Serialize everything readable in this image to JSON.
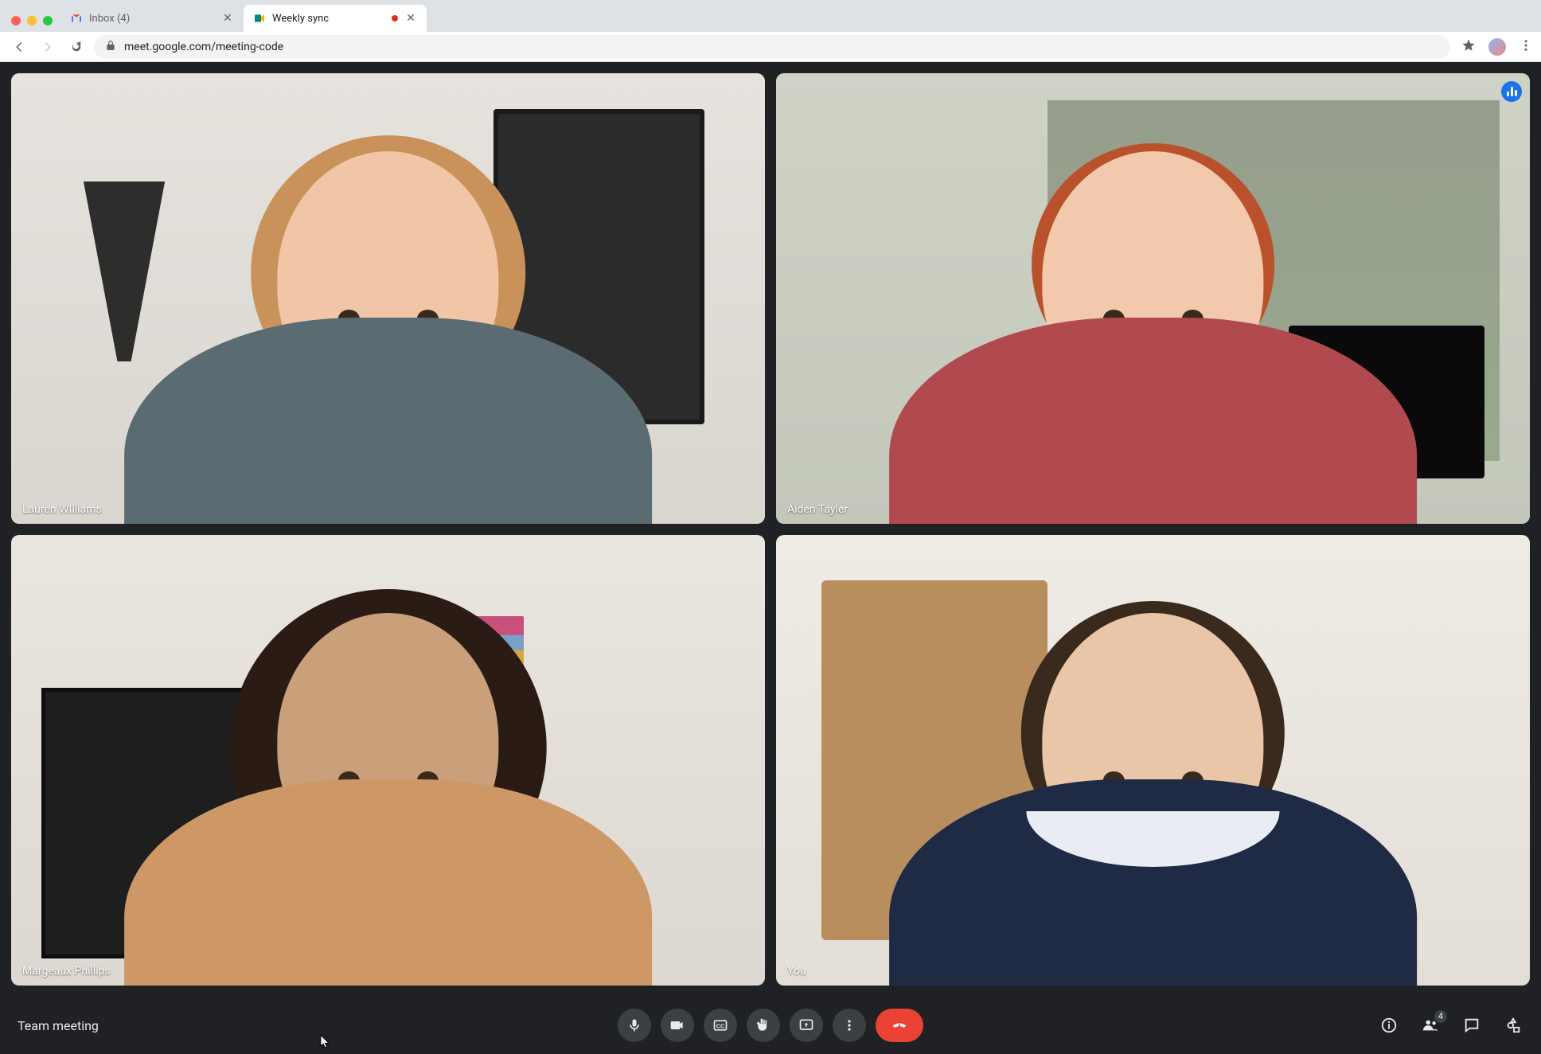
{
  "browser": {
    "tabs": [
      {
        "title": "Inbox (4)",
        "favicon": "gmail",
        "active": false
      },
      {
        "title": "Weekly sync",
        "favicon": "meet",
        "active": true,
        "recording": true
      }
    ],
    "url": "meet.google.com/meeting-code"
  },
  "meet": {
    "meeting_name": "Team meeting",
    "participants_badge": "4",
    "tiles": [
      {
        "name": "Lauren WIlliams",
        "speaking": false
      },
      {
        "name": "Aiden Tayler",
        "speaking": true
      },
      {
        "name": "Margeaux Phillips",
        "speaking": false
      },
      {
        "name": "You",
        "speaking": false
      }
    ],
    "controls": {
      "mic": "microphone-icon",
      "camera": "video-icon",
      "captions": "captions-icon",
      "raise_hand": "raise-hand-icon",
      "present": "present-icon",
      "more": "more-icon",
      "hangup": "hangup-icon"
    },
    "right_controls": {
      "info": "info-icon",
      "people": "people-icon",
      "chat": "chat-icon",
      "activities": "activities-icon"
    }
  }
}
